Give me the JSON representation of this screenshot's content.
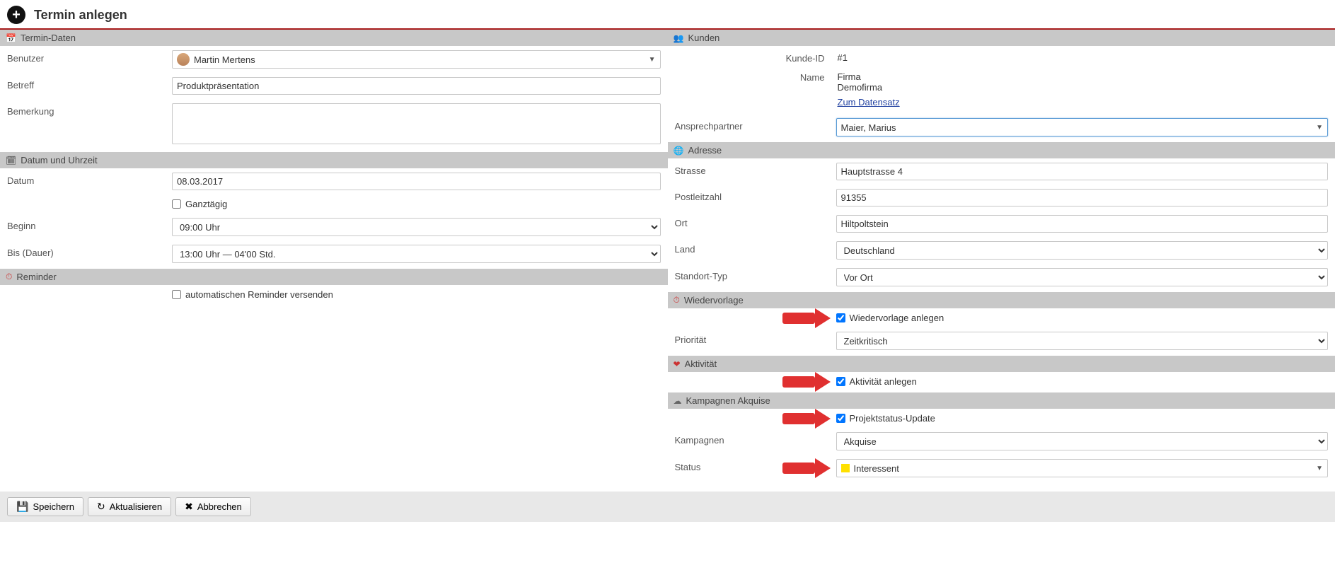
{
  "header": {
    "title": "Termin anlegen"
  },
  "termin_daten": {
    "section": "Termin-Daten",
    "benutzer_label": "Benutzer",
    "benutzer_value": "Martin Mertens",
    "betreff_label": "Betreff",
    "betreff_value": "Produktpräsentation",
    "bemerkung_label": "Bemerkung",
    "bemerkung_value": ""
  },
  "datum_uhrzeit": {
    "section": "Datum und Uhrzeit",
    "datum_label": "Datum",
    "datum_value": "08.03.2017",
    "ganztaegig_label": "Ganztägig",
    "ganztaegig_checked": false,
    "beginn_label": "Beginn",
    "beginn_value": "09:00 Uhr",
    "bis_label": "Bis (Dauer)",
    "bis_value": "13:00 Uhr — 04'00 Std."
  },
  "reminder": {
    "section": "Reminder",
    "auto_label": "automatischen Reminder versenden",
    "auto_checked": false
  },
  "kunden": {
    "section": "Kunden",
    "kunde_id_label": "Kunde-ID",
    "kunde_id_value": "#1",
    "name_label": "Name",
    "name_line1": "Firma",
    "name_line2": "Demofirma",
    "link_label": "Zum Datensatz",
    "ansprechpartner_label": "Ansprechpartner",
    "ansprechpartner_value": "Maier, Marius"
  },
  "adresse": {
    "section": "Adresse",
    "strasse_label": "Strasse",
    "strasse_value": "Hauptstrasse 4",
    "plz_label": "Postleitzahl",
    "plz_value": "91355",
    "ort_label": "Ort",
    "ort_value": "Hiltpoltstein",
    "land_label": "Land",
    "land_value": "Deutschland",
    "standort_label": "Standort-Typ",
    "standort_value": "Vor Ort"
  },
  "wiedervorlage": {
    "section": "Wiedervorlage",
    "anlegen_label": "Wiedervorlage anlegen",
    "anlegen_checked": true,
    "prio_label": "Priorität",
    "prio_value": "Zeitkritisch"
  },
  "aktivitaet": {
    "section": "Aktivität",
    "anlegen_label": "Aktivität anlegen",
    "anlegen_checked": true
  },
  "kampagnen": {
    "section": "Kampagnen Akquise",
    "update_label": "Projektstatus-Update",
    "update_checked": true,
    "kampagne_label": "Kampagnen",
    "kampagne_value": "Akquise",
    "status_label": "Status",
    "status_value": "Interessent",
    "status_color": "#ffe000"
  },
  "buttons": {
    "save": "Speichern",
    "refresh": "Aktualisieren",
    "cancel": "Abbrechen"
  }
}
